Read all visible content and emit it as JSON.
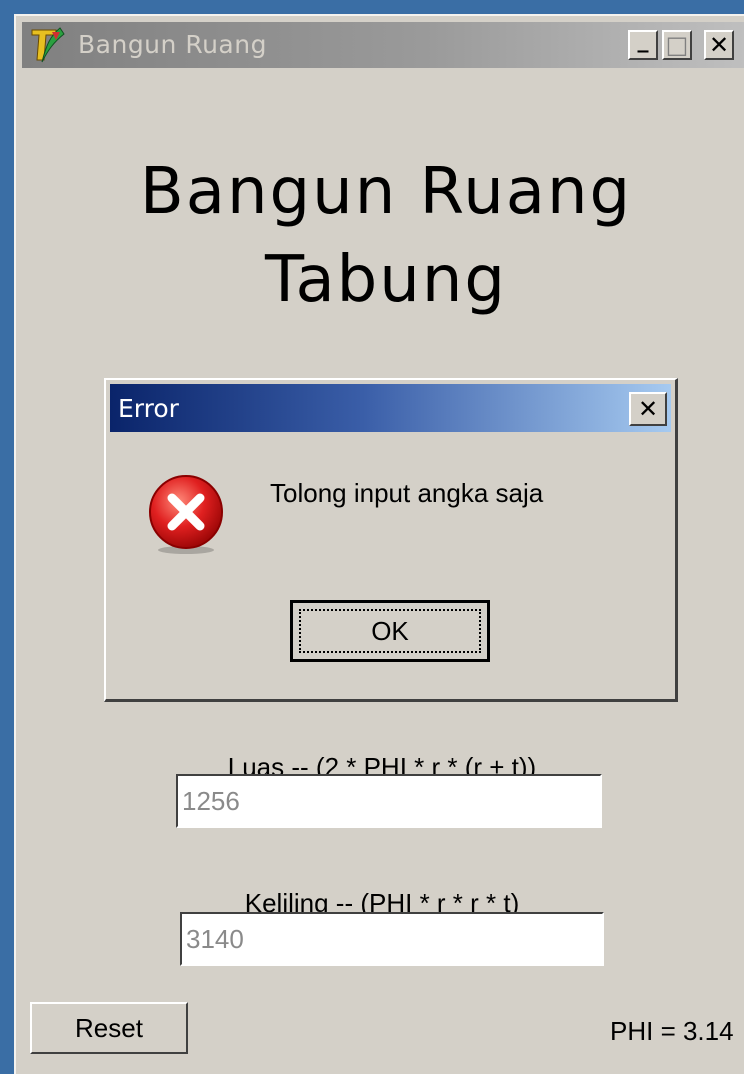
{
  "window": {
    "title": "Bangun Ruang",
    "minimize_glyph": "_",
    "maximize_glyph": "□",
    "close_glyph": "✕"
  },
  "main": {
    "title_line1": "Bangun Ruang",
    "title_line2": "Tabung",
    "luas_label": "Luas -- (2 * PHI * r * (r + t))",
    "luas_value": "1256",
    "keliling_label": "Keliling -- (PHI * r * r * t)",
    "keliling_value": "3140",
    "reset_label": "Reset",
    "phi_label": "PHI = 3.14"
  },
  "dialog": {
    "title": "Error",
    "close_glyph": "✕",
    "message": "Tolong input angka saja",
    "ok_label": "OK",
    "icon": "error-icon"
  },
  "colors": {
    "desktop": "#3a6ea5",
    "window_bg": "#d4d0c8",
    "dialog_title_start": "#0a246a",
    "dialog_title_end": "#a6caf0",
    "error_red": "#e02020"
  }
}
